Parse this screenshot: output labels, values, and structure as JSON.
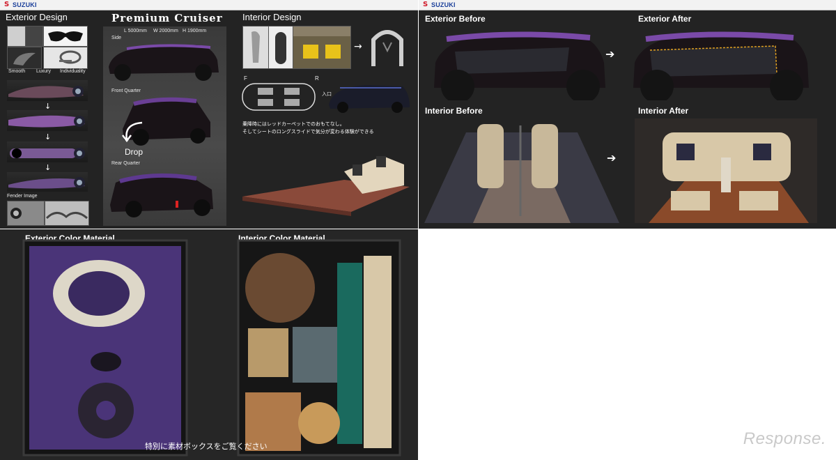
{
  "brand": {
    "name": "SUZUKI",
    "color": "#1a3f9a",
    "mark_color": "#d11a2a"
  },
  "panel1": {
    "exterior_design_title": "Exterior Design",
    "main_title": "Premium Cruiser",
    "dims": {
      "l": "L 5000mm",
      "w": "W 2000mm",
      "h": "H 1900mm"
    },
    "keywords": [
      "Smooth",
      "Luxury",
      "Individuality"
    ],
    "views": {
      "side": "Side",
      "front_quarter": "Front Quarter",
      "rear_quarter": "Rear Quarter"
    },
    "drop_label": "Drop",
    "fender_image": "Fender Image",
    "interior_design_title": "Interior Design",
    "layout_labels": {
      "f": "F",
      "r": "R",
      "entrance": "入口"
    },
    "caption": [
      "乗降時にはレッドカーペットでのおもてなし。",
      "そしてシートのロングスライドで気分が変わる体験ができる"
    ]
  },
  "panel2": {
    "exterior_before": "Exterior Before",
    "exterior_after": "Exterior After",
    "interior_before": "Interior Before",
    "interior_after": "Interior After"
  },
  "panel3": {
    "exterior_color_material": "Exterior Color Material",
    "interior_color_material": "Interior Color Material",
    "caption": "特別に素材ボックスをご覧ください"
  },
  "watermark": "Response.",
  "colors": {
    "panel_bg": "#232323",
    "purple": "#5a3a85",
    "carpet": "#8a4a3a"
  }
}
